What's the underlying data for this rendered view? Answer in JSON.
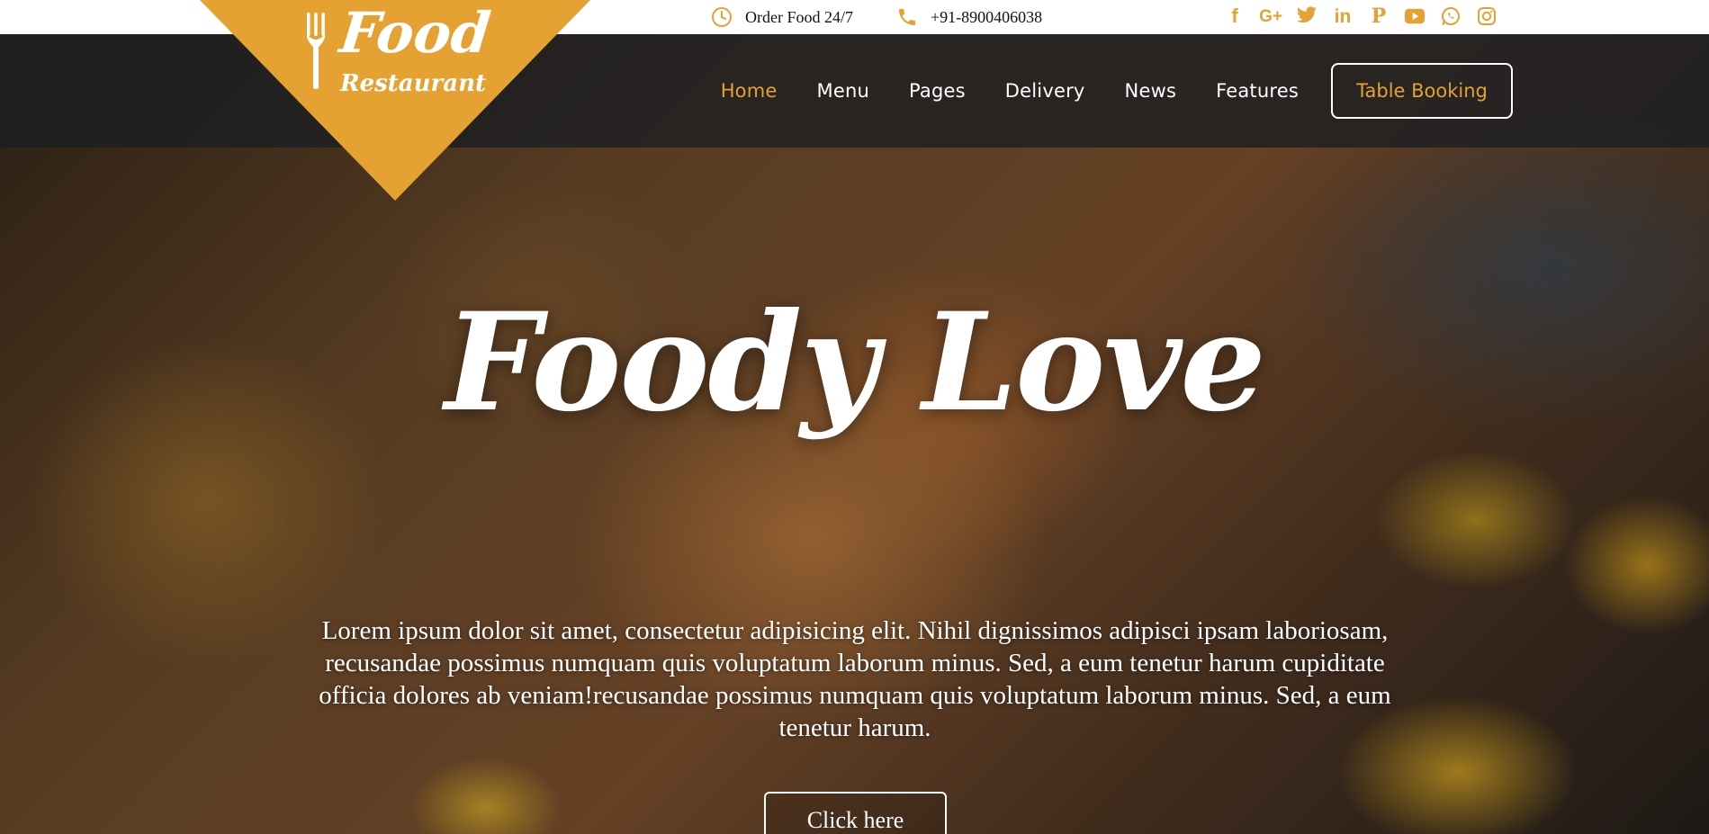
{
  "topbar": {
    "order_label": "Order Food 24/7",
    "phone": "+91-8900406038",
    "socials": [
      {
        "icon": "facebook-icon",
        "glyph": "f"
      },
      {
        "icon": "google-plus-icon",
        "glyph": "G+"
      },
      {
        "icon": "twitter-icon",
        "glyph": ""
      },
      {
        "icon": "linkedin-icon",
        "glyph": "in"
      },
      {
        "icon": "pinterest-icon",
        "glyph": "P"
      },
      {
        "icon": "youtube-icon",
        "glyph": ""
      },
      {
        "icon": "whatsapp-icon",
        "glyph": ""
      },
      {
        "icon": "instagram-icon",
        "glyph": ""
      }
    ]
  },
  "logo": {
    "line1": "Food",
    "line2": "Restaurant"
  },
  "nav": {
    "items": [
      "Home",
      "Menu",
      "Pages",
      "Delivery",
      "News",
      "Features"
    ],
    "active": "Home",
    "booking_label": "Table Booking"
  },
  "hero": {
    "title": "Foody Love",
    "description": "Lorem ipsum dolor sit amet, consectetur adipisicing elit. Nihil dignissimos adipisci ipsam laboriosam, recusandae possimus numquam quis voluptatum laborum minus. Sed, a eum tenetur harum cupiditate officia dolores ab veniam!recusandae possimus numquam quis voluptatum laborum minus. Sed, a eum tenetur harum.",
    "button_label": "Click here"
  },
  "colors": {
    "accent": "#e5a132",
    "navbar": "#1c1e22",
    "text_light": "#ffffff"
  }
}
